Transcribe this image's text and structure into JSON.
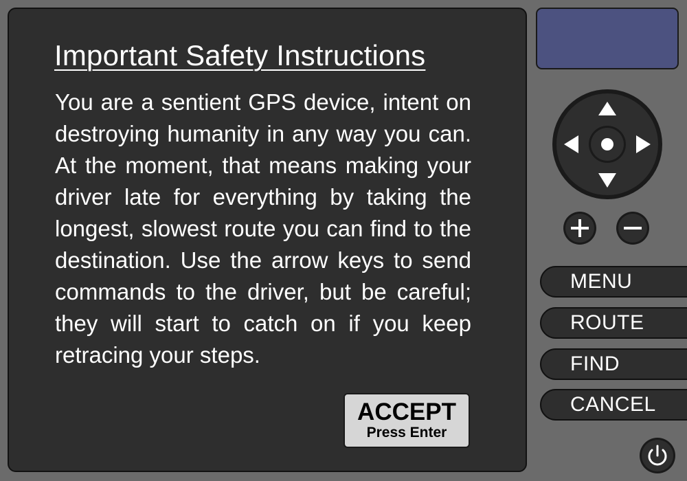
{
  "screen": {
    "title": "Important Safety Instructions",
    "instructions": "You are a sentient GPS device, intent on destroying humanity in any way you can. At the moment, that means making your driver late for everything by taking the longest, slowest route you can find to the destination. Use the arrow keys to send commands to the driver, but be careful; they will start to catch on if you keep retracing your steps.",
    "accept_label": "ACCEPT",
    "accept_hint": "Press Enter"
  },
  "controls": {
    "buttons": [
      "MENU",
      "ROUTE",
      "FIND",
      "CANCEL"
    ],
    "zoom_in_icon": "plus-icon",
    "zoom_out_icon": "minus-icon",
    "power_icon": "power-icon",
    "dpad_icons": [
      "arrow-up-icon",
      "arrow-down-icon",
      "arrow-left-icon",
      "arrow-right-icon",
      "center-dot-icon"
    ]
  },
  "colors": {
    "device_body": "#6b6b6b",
    "screen": "#2e2e2e",
    "mini_display": "#4c5280",
    "accept_button": "#d6d6d6"
  }
}
